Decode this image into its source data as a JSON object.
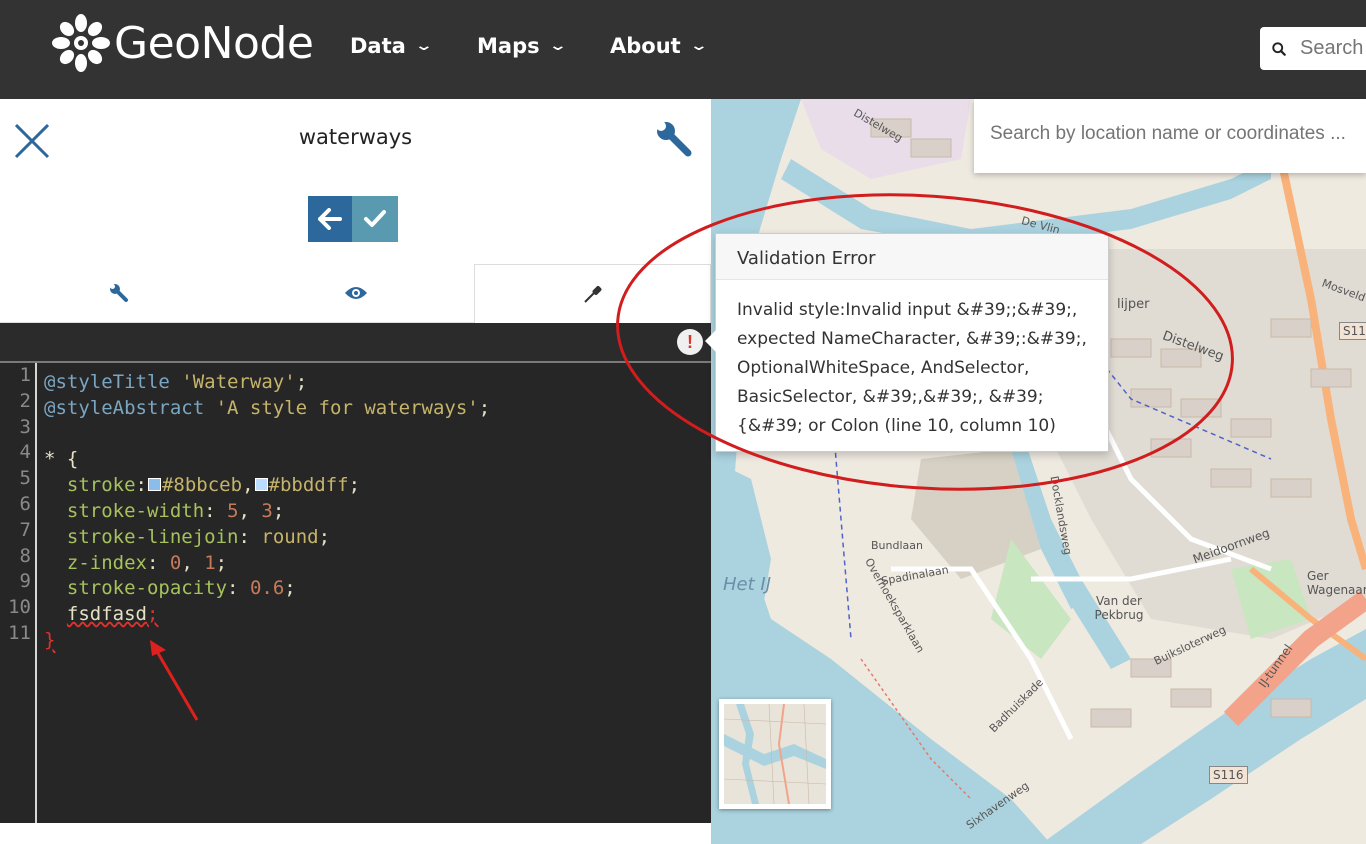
{
  "navbar": {
    "brand": "GeoNode",
    "menu": [
      {
        "label": "Data"
      },
      {
        "label": "Maps"
      },
      {
        "label": "About"
      }
    ],
    "search_placeholder": "Search"
  },
  "panel": {
    "layer_title": "waterways",
    "tabs": [
      {
        "icon": "wrench-icon"
      },
      {
        "icon": "eye-icon"
      },
      {
        "icon": "eyedropper-icon"
      }
    ]
  },
  "editor": {
    "line_numbers": [
      "1",
      "2",
      "3",
      "4",
      "5",
      "6",
      "7",
      "8",
      "9",
      "10",
      "11"
    ],
    "lines": {
      "l1_kw": "@styleTitle",
      "l1_str": "'Waterway'",
      "l2_kw": "@styleAbstract",
      "l2_str": "'A style for waterways'",
      "l4": "* {",
      "l5_prop": "stroke",
      "l5_c1": "#8bbceb",
      "l5_c2": "#bbddff",
      "l6_prop": "stroke-width",
      "l6_v1": "5",
      "l6_v2": "3",
      "l7_prop": "stroke-linejoin",
      "l7_val": "round",
      "l8_prop": "z-index",
      "l8_v1": "0",
      "l8_v2": "1",
      "l9_prop": "stroke-opacity",
      "l9_val": "0.6",
      "l10_err": "fsdfasd",
      "l11": "}"
    },
    "error_badge": "!"
  },
  "popover": {
    "title": "Validation Error",
    "lines": [
      "Invalid style:Invalid input &#39;;&#39;,",
      "expected NameCharacter, &#39;:&#39;,",
      "OptionalWhiteSpace, AndSelector,",
      "BasicSelector, &#39;,&#39;, &#39;",
      "{&#39; or Colon (line 10, column 10)"
    ]
  },
  "map": {
    "search_placeholder": "Search by location name or coordinates ...",
    "labels": {
      "distelweg_top": "Distelweg",
      "distelweg_mid": "Distelweg",
      "de_vlin": "De Vlin",
      "klijper": "lijper",
      "bundlaan": "Bundlaan",
      "spadinalaan": "Spadinalaan",
      "overhoeksparklaan": "Overhoeksparklaan",
      "docklandsweg": "Docklandsweg",
      "van_der_pekbrug": "Van der Pekbrug",
      "meidoornweg": "Meidoornweg",
      "buiksloterweg": "Buiksloterweg",
      "badhuiskade": "Badhuiskade",
      "ij_tunnel": "IJ-tunnel",
      "s116_bottom": "S116",
      "s116_top": "S11",
      "het_ij": "Het IJ",
      "sixhavenweg": "Sixhavenweg",
      "mosveld": "Mosveld",
      "gerwagenaar": "Ger Wagenaar"
    }
  }
}
